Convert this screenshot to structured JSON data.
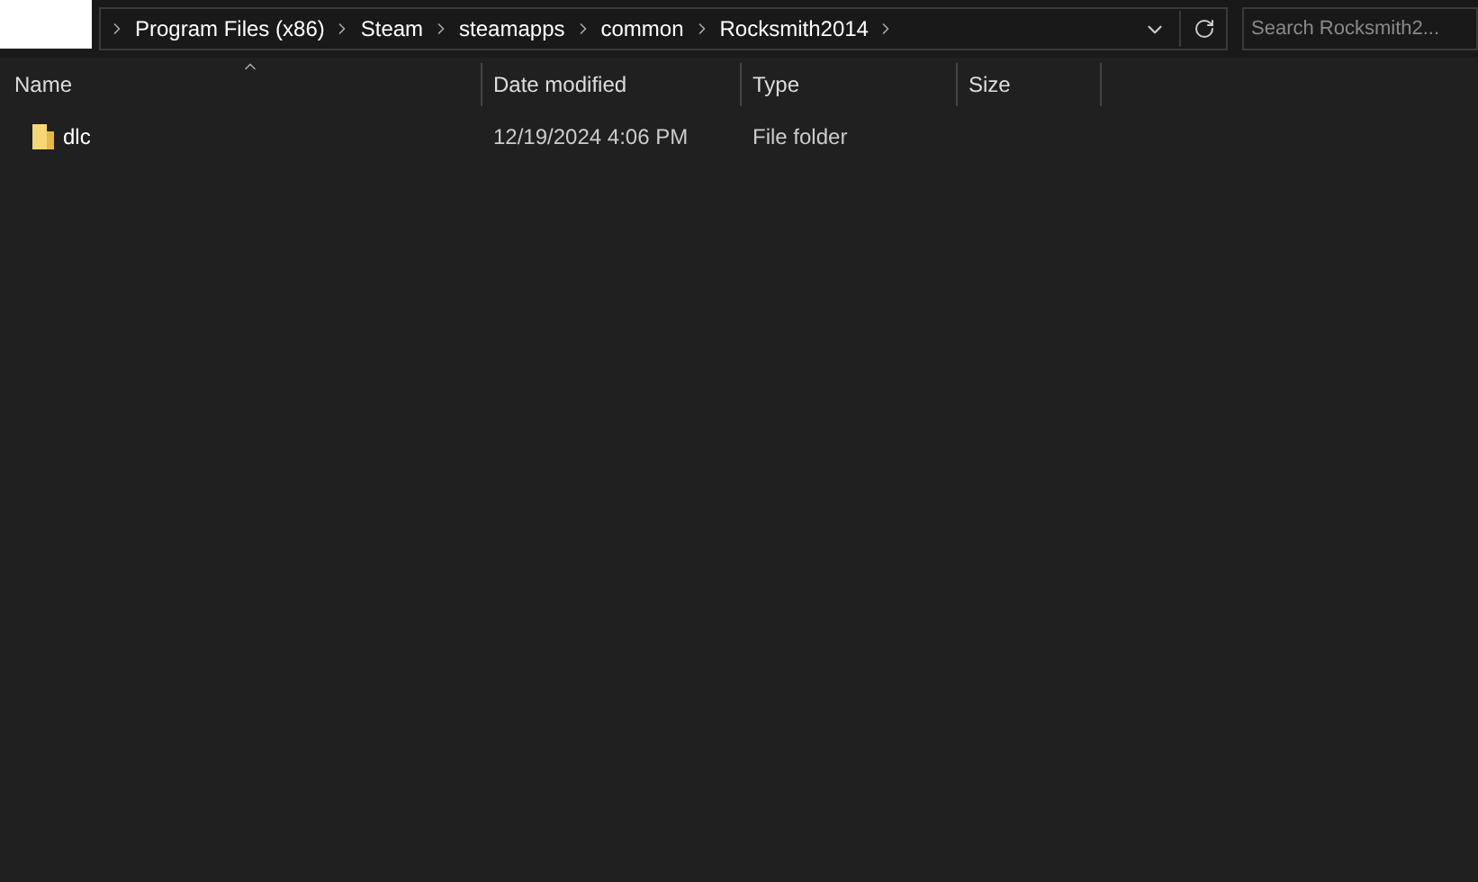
{
  "address_bar": {
    "breadcrumbs": [
      "Program Files (x86)",
      "Steam",
      "steamapps",
      "common",
      "Rocksmith2014"
    ]
  },
  "search": {
    "placeholder": "Search Rocksmith2..."
  },
  "table": {
    "columns": [
      {
        "label": "Name",
        "sorted": true
      },
      {
        "label": "Date modified",
        "sorted": false
      },
      {
        "label": "Type",
        "sorted": false
      },
      {
        "label": "Size",
        "sorted": false
      }
    ],
    "rows": [
      {
        "kind": "folder",
        "name": "dlc",
        "date_modified": "12/19/2024 4:06 PM",
        "type": "File folder",
        "size": "",
        "selected": false
      }
    ]
  }
}
